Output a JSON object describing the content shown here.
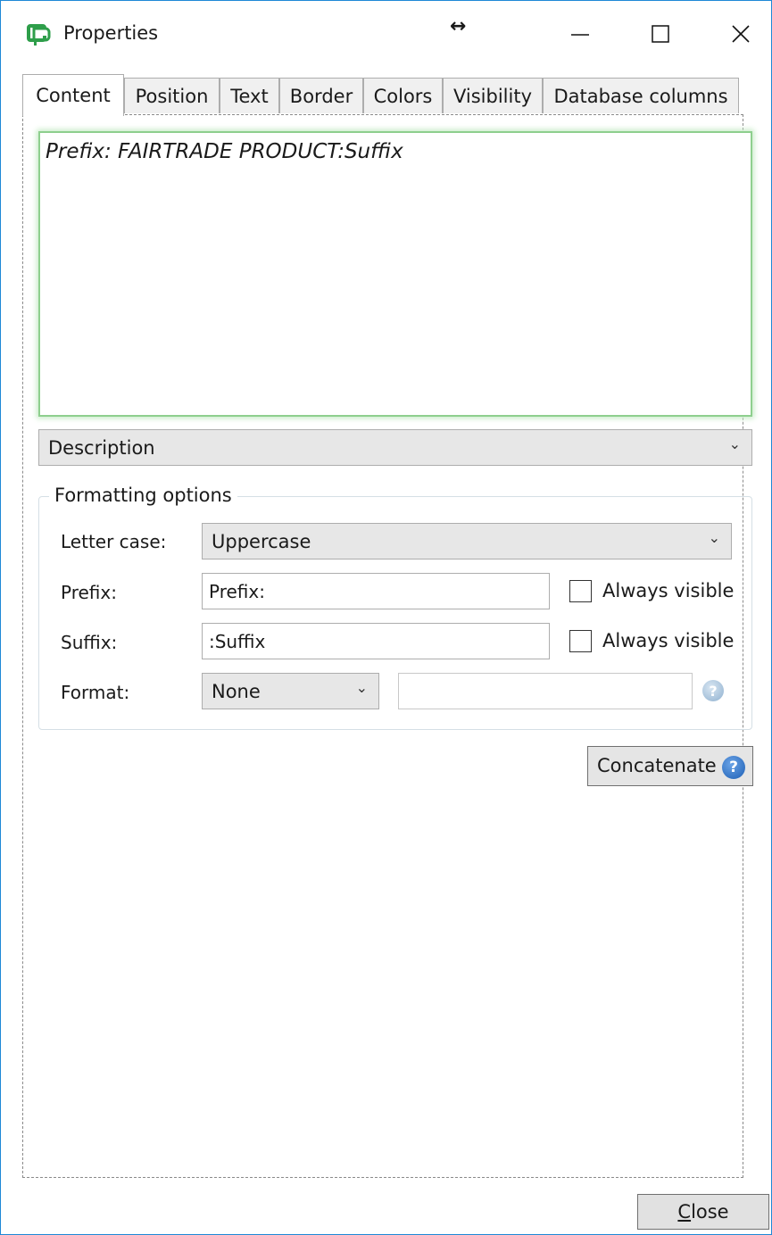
{
  "window": {
    "title": "Properties",
    "controls": {
      "minimize": "minimize",
      "maximize": "maximize",
      "close": "close"
    }
  },
  "tabs": [
    {
      "label": "Content",
      "active": true
    },
    {
      "label": "Position",
      "active": false
    },
    {
      "label": "Text",
      "active": false
    },
    {
      "label": "Border",
      "active": false
    },
    {
      "label": "Colors",
      "active": false
    },
    {
      "label": "Visibility",
      "active": false
    },
    {
      "label": "Database columns",
      "active": false
    }
  ],
  "preview": {
    "text": "Prefix: FAIRTRADE PRODUCT:Suffix"
  },
  "source_select": {
    "value": "Description"
  },
  "formatting": {
    "title": "Formatting options",
    "letter_case": {
      "label": "Letter case:",
      "value": "Uppercase"
    },
    "prefix": {
      "label": "Prefix:",
      "value": "Prefix:",
      "always_visible_label": "Always visible",
      "always_visible": false
    },
    "suffix": {
      "label": "Suffix:",
      "value": ":Suffix",
      "always_visible_label": "Always visible",
      "always_visible": false
    },
    "format": {
      "label": "Format:",
      "value": "None",
      "custom_value": ""
    }
  },
  "concatenate_button": {
    "label": "Concatenate"
  },
  "close_button": {
    "label_accel": "C",
    "label_rest": "lose"
  },
  "colors": {
    "accent_border": "#1e88d6",
    "preview_glow": "#8ecf8e",
    "help_blue": "#1d5fb5"
  }
}
